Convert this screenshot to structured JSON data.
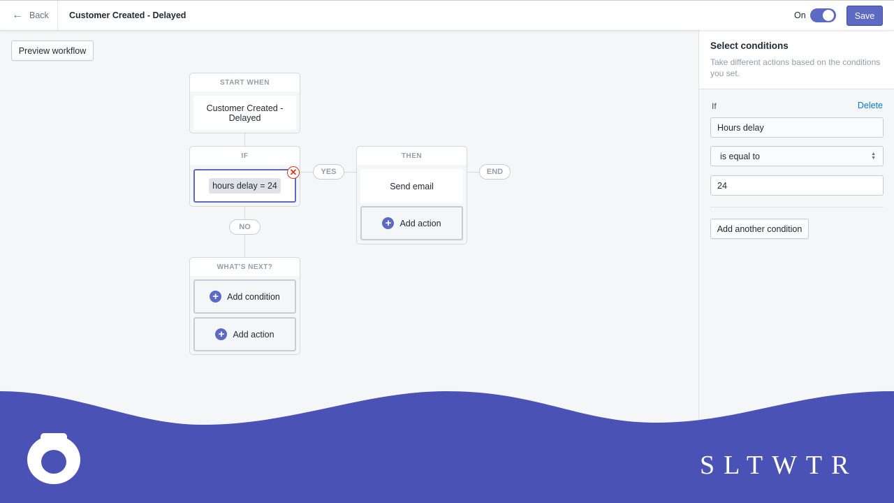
{
  "header": {
    "back_label": "Back",
    "title": "Customer Created - Delayed",
    "toggle_label": "On",
    "toggle_on": true,
    "save_label": "Save"
  },
  "canvas": {
    "preview_label": "Preview workflow",
    "start": {
      "heading": "START WHEN",
      "trigger": "Customer Created - Delayed"
    },
    "if": {
      "heading": "IF",
      "condition": "hours delay = 24"
    },
    "yes_label": "YES",
    "no_label": "NO",
    "end_label": "END",
    "then": {
      "heading": "THEN",
      "action": "Send email",
      "add_action": "Add action"
    },
    "next": {
      "heading": "WHAT'S NEXT?",
      "add_condition": "Add condition",
      "add_action": "Add action"
    }
  },
  "panel": {
    "title": "Select conditions",
    "description": "Take different actions based on the conditions you set.",
    "if_label": "If",
    "delete_label": "Delete",
    "field": "Hours delay",
    "operator": "is equal to",
    "value": "24",
    "add_condition": "Add another condition"
  },
  "footer": {
    "brand": "SLTWTR"
  },
  "colors": {
    "accent": "#5c6ac4",
    "banner": "#4a52b5",
    "delete_link": "#007ace",
    "error": "#de3618"
  }
}
